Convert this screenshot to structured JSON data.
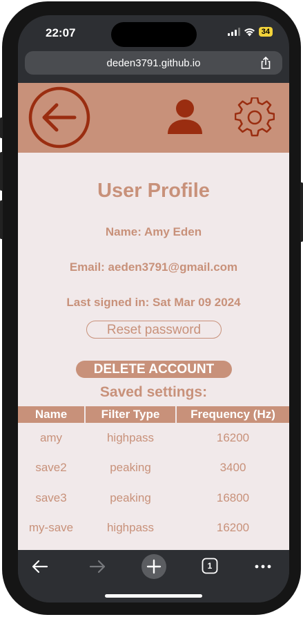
{
  "status_bar": {
    "time": "22:07",
    "battery": "34"
  },
  "browser": {
    "url": "deden3791.github.io"
  },
  "header": {
    "back_icon": "arrow-left-circle-icon",
    "user_icon": "user-silhouette-icon",
    "settings_icon": "gear-icon"
  },
  "profile": {
    "title": "User Profile",
    "name_line": "Name: Amy Eden",
    "email_line": "Email: aeden3791@gmail.com",
    "last_signed_line": "Last signed in: Sat Mar 09 2024",
    "reset_label": "Reset password",
    "delete_label": "DELETE ACCOUNT"
  },
  "saved": {
    "title": "Saved settings:",
    "columns": [
      "Name",
      "Filter Type",
      "Frequency (Hz)"
    ],
    "rows": [
      [
        "amy",
        "highpass",
        "16200"
      ],
      [
        "save2",
        "peaking",
        "3400"
      ],
      [
        "save3",
        "peaking",
        "16800"
      ],
      [
        "my-save",
        "highpass",
        "16200"
      ]
    ]
  },
  "toolbar": {
    "tab_count": "1"
  },
  "colors": {
    "accent": "#c8917a",
    "page_bg": "#f1e9ea",
    "icon_dark": "#9a2d10"
  }
}
